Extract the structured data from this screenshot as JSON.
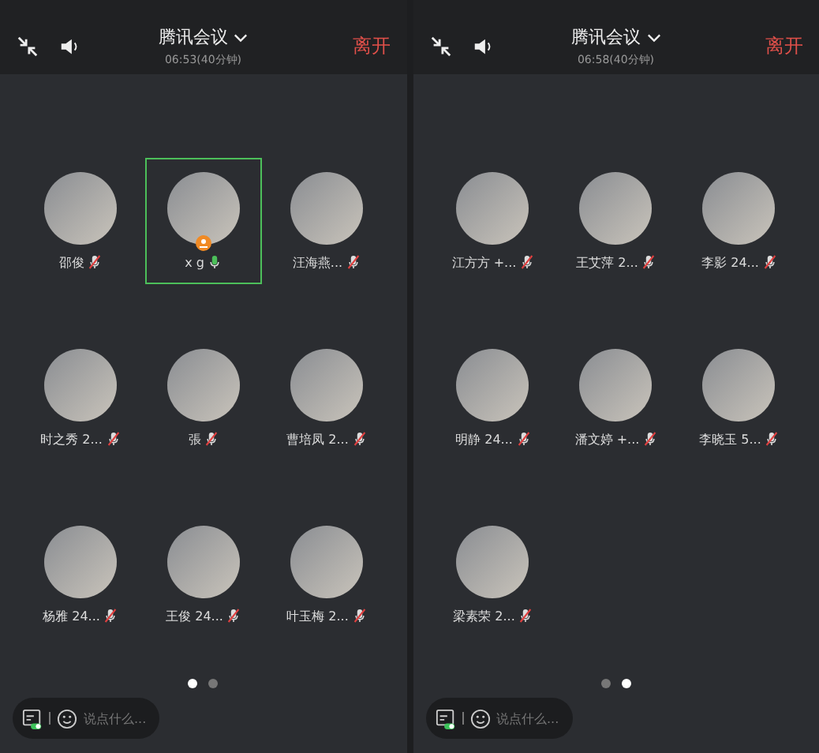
{
  "screens": [
    {
      "title": "腾讯会议",
      "subtitle": "06:53(40分钟)",
      "leave": "离开",
      "participants": [
        {
          "name": "邵俊",
          "muted": true,
          "speaking": false,
          "host": false
        },
        {
          "name": "x g",
          "muted": false,
          "speaking": true,
          "host": true
        },
        {
          "name": "汪海燕...",
          "muted": true,
          "speaking": false,
          "host": false
        },
        {
          "name": "时之秀 2...",
          "muted": true,
          "speaking": false,
          "host": false
        },
        {
          "name": "張",
          "muted": true,
          "speaking": false,
          "host": false
        },
        {
          "name": "曹培凤 2...",
          "muted": true,
          "speaking": false,
          "host": false
        },
        {
          "name": "杨雅 24...",
          "muted": true,
          "speaking": false,
          "host": false
        },
        {
          "name": "王俊 24...",
          "muted": true,
          "speaking": false,
          "host": false
        },
        {
          "name": "叶玉梅 2...",
          "muted": true,
          "speaking": false,
          "host": false
        }
      ],
      "pages": [
        {
          "selected": true
        },
        {
          "selected": false
        }
      ],
      "chat_placeholder": "说点什么..."
    },
    {
      "title": "腾讯会议",
      "subtitle": "06:58(40分钟)",
      "leave": "离开",
      "participants": [
        {
          "name": "江方方 +...",
          "muted": true,
          "speaking": false,
          "host": false
        },
        {
          "name": "王艾萍 2...",
          "muted": true,
          "speaking": false,
          "host": false
        },
        {
          "name": "李影 24...",
          "muted": true,
          "speaking": false,
          "host": false
        },
        {
          "name": "明静 24...",
          "muted": true,
          "speaking": false,
          "host": false
        },
        {
          "name": "潘文婷 +...",
          "muted": true,
          "speaking": false,
          "host": false
        },
        {
          "name": "李晓玉 5...",
          "muted": true,
          "speaking": false,
          "host": false
        },
        {
          "name": "梁素荣 2...",
          "muted": true,
          "speaking": false,
          "host": false
        }
      ],
      "pages": [
        {
          "selected": false
        },
        {
          "selected": true
        }
      ],
      "chat_placeholder": "说点什么..."
    }
  ]
}
